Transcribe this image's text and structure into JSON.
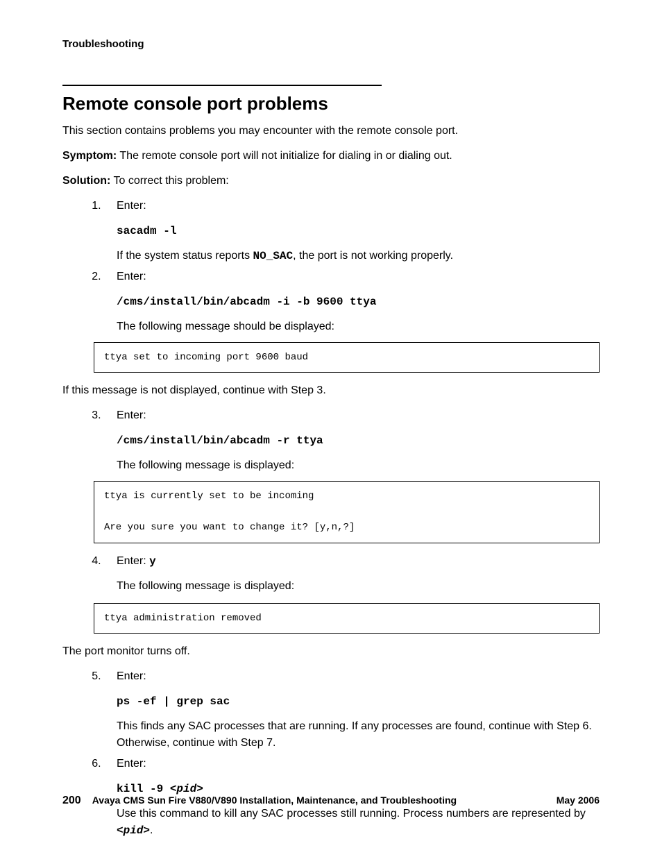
{
  "running_head": "Troubleshooting",
  "section_title": "Remote console port problems",
  "intro": "This section contains problems you may encounter with the remote console port.",
  "symptom_label": "Symptom:",
  "symptom_text": " The remote console port will not initialize for dialing in or dialing out.",
  "solution_label": "Solution:",
  "solution_text": " To correct this problem:",
  "steps": {
    "s1": {
      "lead": "Enter:",
      "cmd": "sacadm -l",
      "after_a": "If the system status reports ",
      "after_code": "NO_SAC",
      "after_b": ", the port is not working properly."
    },
    "s2": {
      "lead": "Enter:",
      "cmd": "/cms/install/bin/abcadm -i -b 9600 ttya",
      "after": "The following message should be displayed:"
    },
    "s3": {
      "lead": "Enter:",
      "cmd": "/cms/install/bin/abcadm -r ttya",
      "after": "The following message is displayed:"
    },
    "s4": {
      "lead": "Enter: ",
      "input": "y",
      "after": "The following message is displayed:"
    },
    "s5": {
      "lead": "Enter:",
      "cmd": "ps -ef | grep sac",
      "after": "This finds any SAC processes that are running. If any processes are found, continue with Step 6. Otherwise, continue with Step 7."
    },
    "s6": {
      "lead": "Enter:",
      "cmd_a": "kill -9 ",
      "cmd_pid": "<pid>",
      "after_a": "Use this command to kill any SAC processes still running. Process numbers are represented by ",
      "after_pid": "<pid>",
      "after_b": "."
    }
  },
  "code_block_1": "ttya set to incoming port 9600 baud",
  "after_block_1": "If this message is not displayed, continue with Step 3.",
  "code_block_2": "ttya is currently set to be incoming\n\nAre you sure you want to change it? [y,n,?]",
  "code_block_3": "ttya administration removed",
  "after_block_3": "The port monitor turns off.",
  "footer": {
    "page": "200",
    "title": "Avaya CMS Sun Fire V880/V890 Installation, Maintenance, and Troubleshooting",
    "date": "May 2006"
  }
}
